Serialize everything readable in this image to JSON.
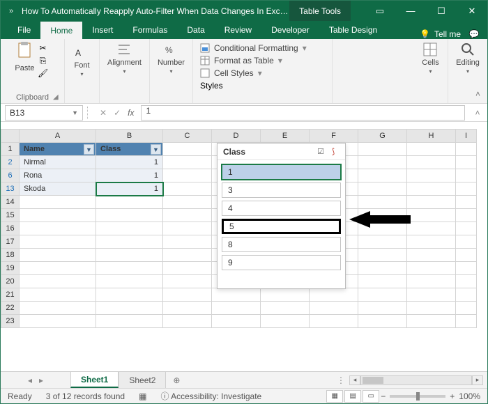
{
  "titlebar": {
    "qat": "»",
    "title": "How To Automatically Reapply Auto-Filter When Data Changes In Excel...",
    "context_tab": "Table Tools"
  },
  "tabs": {
    "file": "File",
    "home": "Home",
    "insert": "Insert",
    "formulas": "Formulas",
    "data": "Data",
    "review": "Review",
    "developer": "Developer",
    "table_design": "Table Design",
    "tell_me": "Tell me"
  },
  "ribbon": {
    "paste": "Paste",
    "clipboard": "Clipboard",
    "font": "Font",
    "alignment": "Alignment",
    "number": "Number",
    "cond_fmt": "Conditional Formatting",
    "fmt_table": "Format as Table",
    "cell_styles": "Cell Styles",
    "styles": "Styles",
    "cells": "Cells",
    "editing": "Editing"
  },
  "fx": {
    "namebox": "B13",
    "value": "1"
  },
  "columns": [
    "A",
    "B",
    "C",
    "D",
    "E",
    "F",
    "G",
    "H",
    "I"
  ],
  "table": {
    "hdr_a": "Name",
    "hdr_b": "Class",
    "rows": [
      {
        "rn": "2",
        "a": "Nirmal",
        "b": "1"
      },
      {
        "rn": "6",
        "a": "Rona",
        "b": "1"
      },
      {
        "rn": "13",
        "a": "Skoda",
        "b": "1"
      }
    ],
    "blank_rows": [
      "14",
      "15",
      "16",
      "17",
      "18",
      "19",
      "20",
      "21",
      "22",
      "23"
    ]
  },
  "slicer": {
    "title": "Class",
    "options": [
      "1",
      "3",
      "4",
      "5",
      "8",
      "9"
    ],
    "selected": "1",
    "highlighted": "5"
  },
  "sheets": {
    "s1": "Sheet1",
    "s2": "Sheet2"
  },
  "status": {
    "ready": "Ready",
    "records": "3 of 12 records found",
    "accessibility": "Accessibility: Investigate",
    "zoom": "100%"
  }
}
